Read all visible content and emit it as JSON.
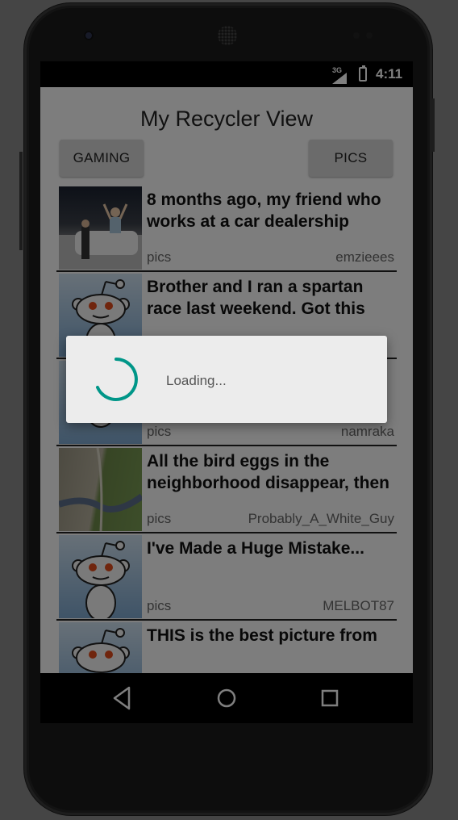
{
  "status_bar": {
    "network": "3G",
    "time": "4:11"
  },
  "app": {
    "title": "My Recycler View",
    "buttons": {
      "gaming": "GAMING",
      "pics": "PICS"
    }
  },
  "posts": [
    {
      "title": "8 months ago, my friend who works at a car dealership",
      "subreddit": "pics",
      "author": "emzieees",
      "thumbnail": "photo"
    },
    {
      "title": "Brother and I ran a spartan race last weekend. Got this",
      "subreddit": "pics",
      "author": "",
      "thumbnail": "reddit-alien"
    },
    {
      "title": "",
      "subreddit": "pics",
      "author": "namraka",
      "thumbnail": "reddit-alien"
    },
    {
      "title": "All the bird eggs in the neighborhood disappear, then",
      "subreddit": "pics",
      "author": "Probably_A_White_Guy",
      "thumbnail": "photo"
    },
    {
      "title": "I've Made a Huge Mistake...",
      "subreddit": "pics",
      "author": "MELBOT87",
      "thumbnail": "reddit-alien"
    },
    {
      "title": "THIS is the best picture from",
      "subreddit": "",
      "author": "",
      "thumbnail": "reddit-alien"
    }
  ],
  "dialog": {
    "message": "Loading...",
    "spinner_color": "#009688"
  },
  "nav_bar": {
    "icons": [
      "back-icon",
      "home-icon",
      "recents-icon"
    ]
  }
}
